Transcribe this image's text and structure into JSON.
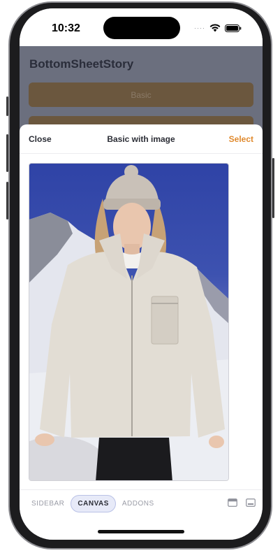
{
  "status_bar": {
    "time": "10:32",
    "cellular": "····"
  },
  "background_app": {
    "title": "BottomSheetStory",
    "buttons": [
      {
        "label": "Basic"
      },
      {
        "label": ""
      }
    ]
  },
  "sheet": {
    "close_label": "Close",
    "title": "Basic with image",
    "select_label": "Select",
    "image": {
      "alt": ""
    }
  },
  "toolbar": {
    "tabs": [
      {
        "label": "SIDEBAR",
        "active": false
      },
      {
        "label": "CANVAS",
        "active": true
      },
      {
        "label": "ADDONS",
        "active": false
      }
    ],
    "icons": [
      "panel-top-icon",
      "panel-bottom-icon"
    ]
  },
  "colors": {
    "accent": "#e08a2e",
    "overlay": "#6b6f7e",
    "button_bg": "#6b573e",
    "active_tab_bg": "#e7eaf8"
  }
}
